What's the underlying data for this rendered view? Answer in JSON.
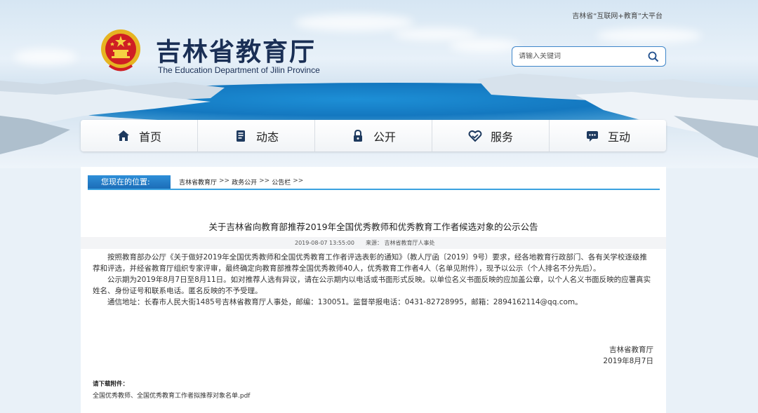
{
  "header": {
    "top_tag": "吉林省“互联网+教育”大平台",
    "title": "吉林省教育厅",
    "subtitle": "The Education Department of Jilin Province",
    "search_placeholder": "请输入关键词"
  },
  "nav": {
    "items": [
      {
        "label": "首页",
        "icon": "home-icon"
      },
      {
        "label": "动态",
        "icon": "document-icon"
      },
      {
        "label": "公开",
        "icon": "lock-icon"
      },
      {
        "label": "服务",
        "icon": "heart-hand-icon"
      },
      {
        "label": "互动",
        "icon": "chat-icon"
      }
    ]
  },
  "location": {
    "label": "您现在的位置:",
    "crumbs": [
      "吉林省教育厅",
      "政务公开",
      "公告栏"
    ],
    "sep": ">>"
  },
  "article": {
    "title": "关于吉林省向教育部推荐2019年全国优秀教师和优秀教育工作者候选对象的公示公告",
    "date": "2019-08-07 13:55:00",
    "source": "来源：  吉林省教育厅人事处",
    "paragraphs": [
      "按照教育部办公厅《关于做好2019年全国优秀教师和全国优秀教育工作者评选表彰的通知》（教人厅函〔2019〕9号）要求，经各地教育行政部门、各有关学校逐级推荐和评选，并经省教育厅组织专家评审，最终确定向教育部推荐全国优秀教师40人，优秀教育工作者4人（名单见附件），现予以公示（个人排名不分先后）。",
      "公示期为2019年8月7日至8月11日。如对推荐人选有异议，请在公示期内以电话或书面形式反映。以单位名义书面反映的应加盖公章，以个人名义书面反映的应署真实姓名、身份证号和联系电话。匿名反映的不予受理。",
      "通信地址：长春市人民大街1485号吉林省教育厅人事处，邮编：130051。监督举报电话：0431-82728995，邮箱：2894162114@qq.com。"
    ],
    "sign_org": "吉林省教育厅",
    "sign_date": "2019年8月7日",
    "attach_head": "请下载附件：",
    "attach_link": "全国优秀教师、全国优秀教育工作者拟推荐对象名单.pdf"
  }
}
